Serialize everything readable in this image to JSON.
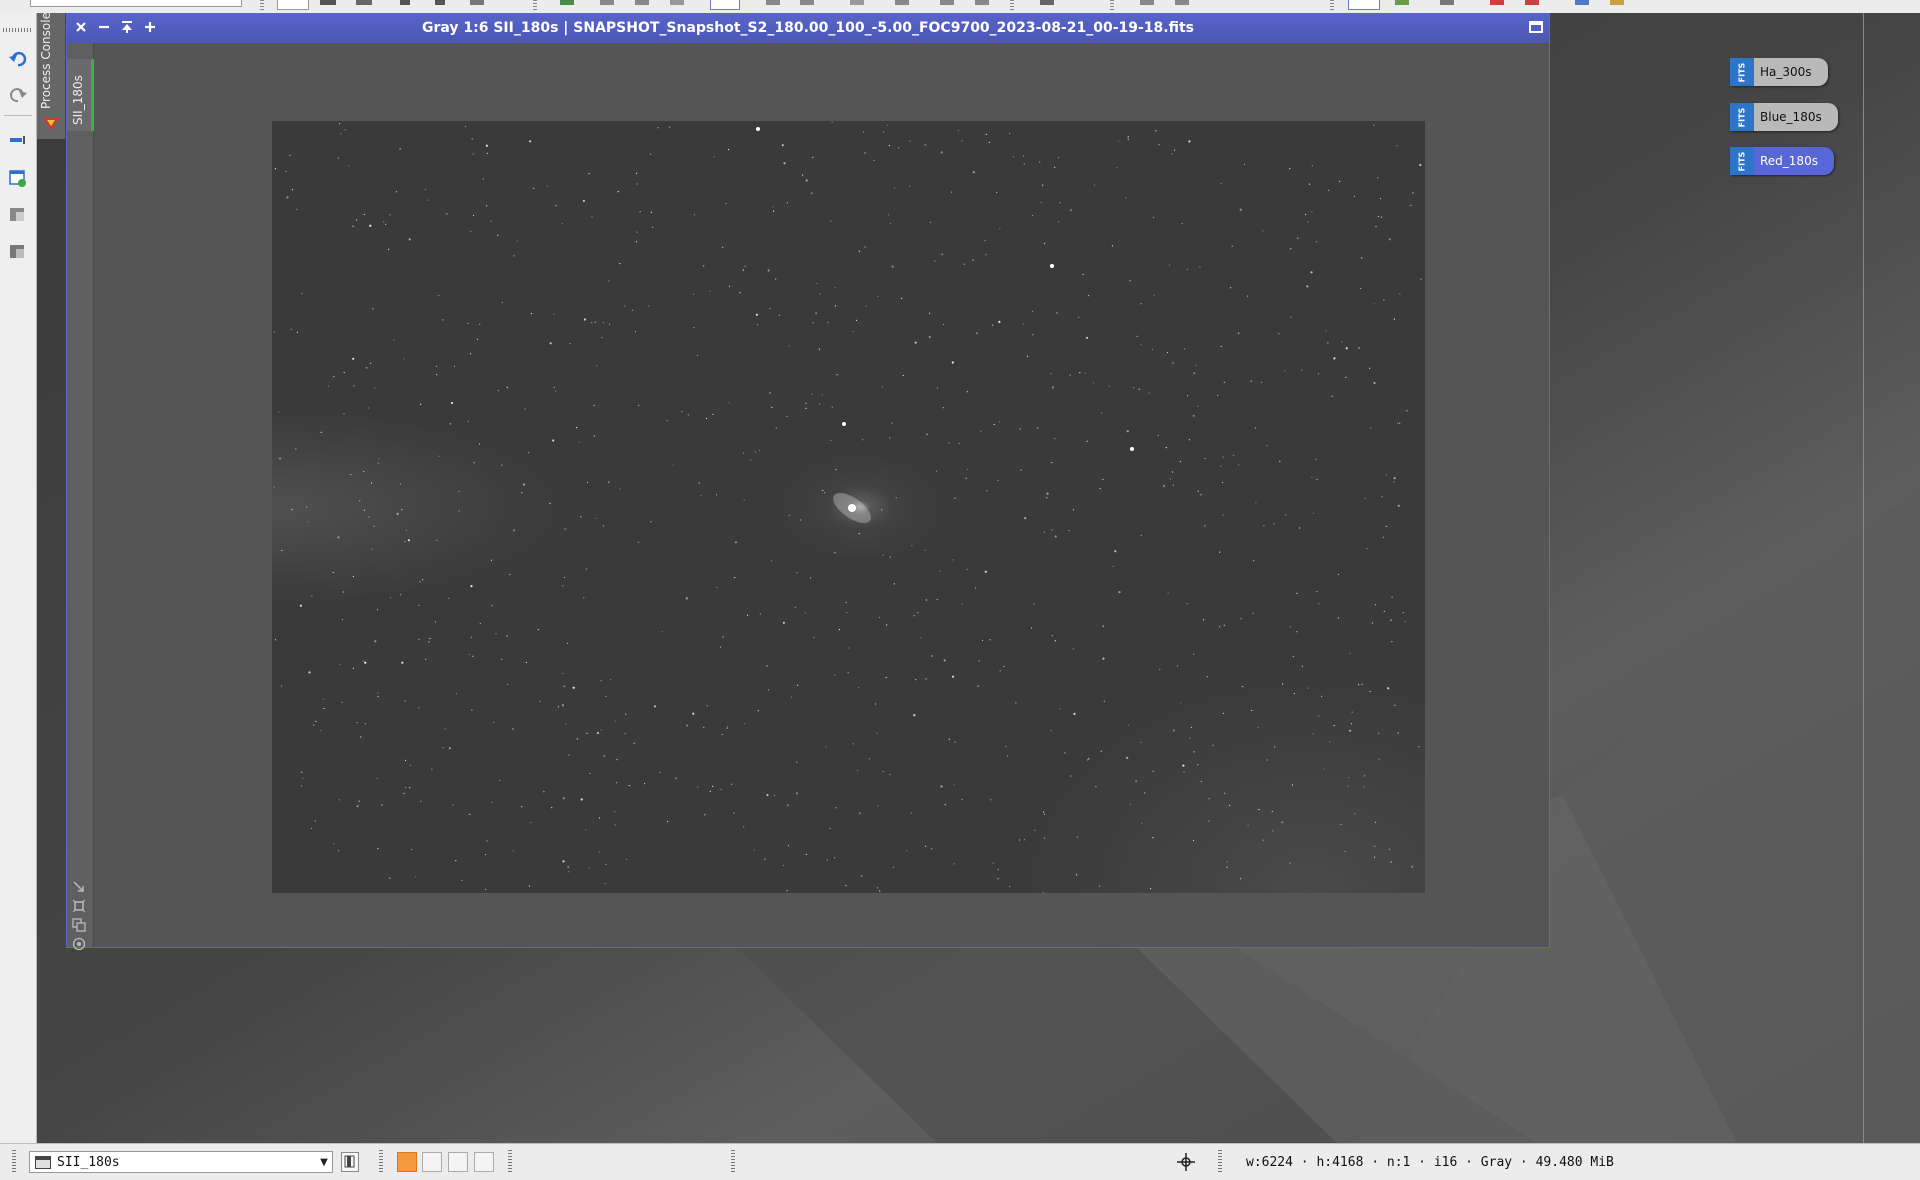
{
  "window": {
    "title": "Gray 1:6 SII_180s | SNAPSHOT_Snapshot_S2_180.00_100_-5.00_FOC9700_2023-08-21_00-19-18.fits",
    "view_tab_label": "SII_180s"
  },
  "side_panel": {
    "process_console_label": "Process Console"
  },
  "desktop_icons": [
    {
      "name": "Ha_300s",
      "badge": "FITS",
      "selected": false
    },
    {
      "name": "Blue_180s",
      "badge": "FITS",
      "selected": false
    },
    {
      "name": "Red_180s",
      "badge": "FITS",
      "selected": true
    }
  ],
  "status_bar": {
    "view_selector_value": "SII_180s",
    "image_info": "w:6224 · h:4168 · n:1 · i16 · Gray · 49.480 MiB"
  },
  "colors": {
    "title_bar": "#5864c8",
    "selected_icon": "#5866d6",
    "view_tab_marker": "#3fae4a",
    "fits_badge": "#2e74c9",
    "swatch_active": "#f59a3c"
  },
  "icons": [
    "close-icon",
    "minimize-icon",
    "shade-icon",
    "maximize-plus-icon",
    "undo-icon",
    "redo-icon",
    "crosshair-icon"
  ]
}
